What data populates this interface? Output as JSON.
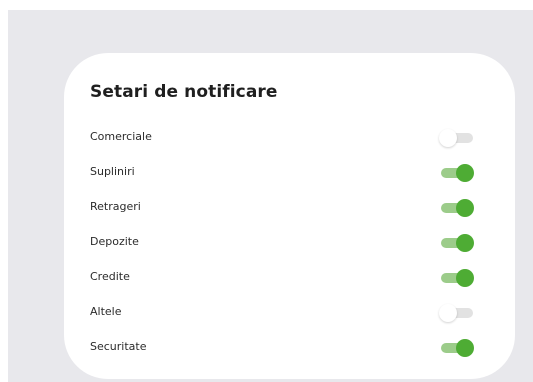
{
  "card": {
    "title": "Setari de notificare"
  },
  "settings": [
    {
      "label": "Comerciale",
      "enabled": false
    },
    {
      "label": "Supliniri",
      "enabled": true
    },
    {
      "label": "Retrageri",
      "enabled": true
    },
    {
      "label": "Depozite",
      "enabled": true
    },
    {
      "label": "Credite",
      "enabled": true
    },
    {
      "label": "Altele",
      "enabled": false
    },
    {
      "label": "Securitate",
      "enabled": true
    }
  ],
  "colors": {
    "toggle_on_knob": "#4eac34",
    "toggle_on_track": "#9ccc8a",
    "toggle_off_track": "#e2e2e2",
    "toggle_off_knob": "#ffffff",
    "background": "#e8e8ec",
    "card": "#ffffff"
  }
}
